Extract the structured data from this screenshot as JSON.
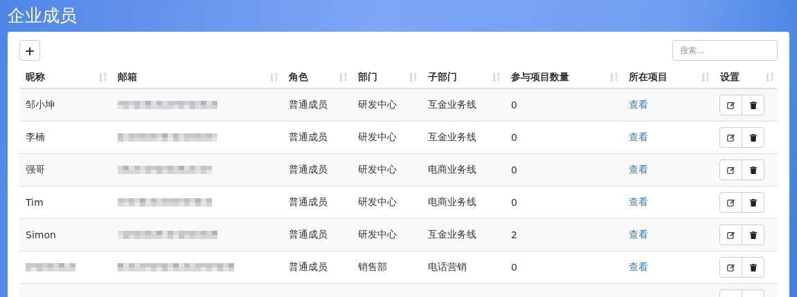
{
  "page_title": "企业成员",
  "toolbar": {
    "add_button": "+",
    "search": {
      "placeholder": "搜索..."
    }
  },
  "table": {
    "columns": [
      "昵称",
      "邮箱",
      "角色",
      "部门",
      "子部门",
      "参与项目数量",
      "所在项目",
      "设置"
    ],
    "rows": [
      {
        "kind": "member",
        "name": "邹小坤",
        "role": "普通成员",
        "department": "研发中心",
        "sub_department": "互金业务线",
        "project_count": "0",
        "projects_link": "查看"
      },
      {
        "kind": "member",
        "name": "李楠",
        "role": "普通成员",
        "department": "研发中心",
        "sub_department": "互金业务线",
        "project_count": "0",
        "projects_link": "查看"
      },
      {
        "kind": "member",
        "name": "强哥",
        "role": "普通成员",
        "department": "研发中心",
        "sub_department": "电商业务线",
        "project_count": "0",
        "projects_link": "查看"
      },
      {
        "kind": "member",
        "name": "Tim",
        "role": "普通成员",
        "department": "研发中心",
        "sub_department": "电商业务线",
        "project_count": "0",
        "projects_link": "查看"
      },
      {
        "kind": "member",
        "name": "Simon",
        "role": "普通成员",
        "department": "研发中心",
        "sub_department": "互金业务线",
        "project_count": "2",
        "projects_link": "查看"
      },
      {
        "kind": "member",
        "role": "普通成员",
        "department": "销售部",
        "sub_department": "电话营销",
        "project_count": "0",
        "projects_link": "查看"
      },
      {
        "kind": "cut_off"
      }
    ]
  }
}
